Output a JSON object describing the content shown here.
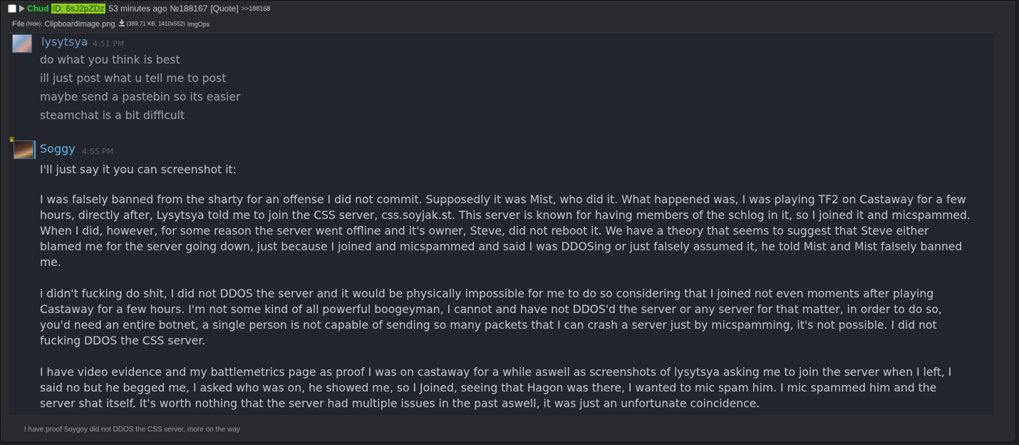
{
  "post": {
    "name": "Chud",
    "id_label": "ID: 6sJ2pZDz",
    "time_ago": "53 minutes ago",
    "number": "№188167",
    "quote_label": "[Quote]",
    "reply_link": ">>188168"
  },
  "file": {
    "label": "File",
    "hide": "(hide):",
    "filename": "ClipboardImage.png",
    "meta": "(389.71 KB, 1410x552)",
    "imgops": "ImgOps"
  },
  "screenshot": {
    "messages": [
      {
        "user": "lysytsya",
        "time": "4:51 PM",
        "lines": [
          "do what you think is best",
          "ill just post what u tell me to post",
          "maybe send a pastebin so its easier",
          "steamchat is a bit difficult"
        ]
      },
      {
        "user": "Soggy",
        "time": "4:55 PM",
        "paragraphs": [
          "I'll just say it you can screenshot it:",
          "I was falsely banned from the sharty for an offense I did not commit. Supposedly it was Mist, who did it. What happened was, I was playing TF2 on Castaway for a few hours, directly after, Lysytsya told me to join the CSS server, css.soyjak.st. This server is known for having members of the schlog in it, so I joined it and micspammed. When I did, however, for some reason the server went offline and it's owner, Steve, did not reboot it. We have a theory that seems to suggest that Steve either blamed me for the server going down, just because I joined and micspammed and said I was DDOSing or just falsely assumed it, he told Mist and Mist falsely banned me.",
          "i didn't fucking do shit, I did not DDOS the server and it would be physically impossible for me to do so considering that I joined not even moments after playing Castaway for a few hours. I'm not some kind of all powerful boogeyman, I cannot and have not DDOS'd the server or any server for that matter, in order to do so, you'd need an entire botnet, a single person is not capable of sending so many packets that I can crash a server just by micspamming, it's not possible. I did not fucking DDOS the CSS server.",
          "I have video evidence and my battlemetrics page as proof I was on castaway for a while aswell as screenshots of lysytsya asking me to join the server when I left, I said no but he begged me, I asked who was on, he showed me, so I Joined, seeing that Hagon was there, I wanted to mic spam him. I mic spammed him and the server shat itself. It's worth nothing that the server had multiple issues in the past aswell, it was just an unfortunate coincidence."
        ]
      }
    ]
  },
  "footer_text": "I have proof Soygoy did not DDOS the CSS server, more on the way",
  "colors": {
    "name": "#24d52c",
    "id_bg": "#8ccc20",
    "screenshot_bg": "#22252c",
    "username_blue": "#5bb8e8"
  }
}
